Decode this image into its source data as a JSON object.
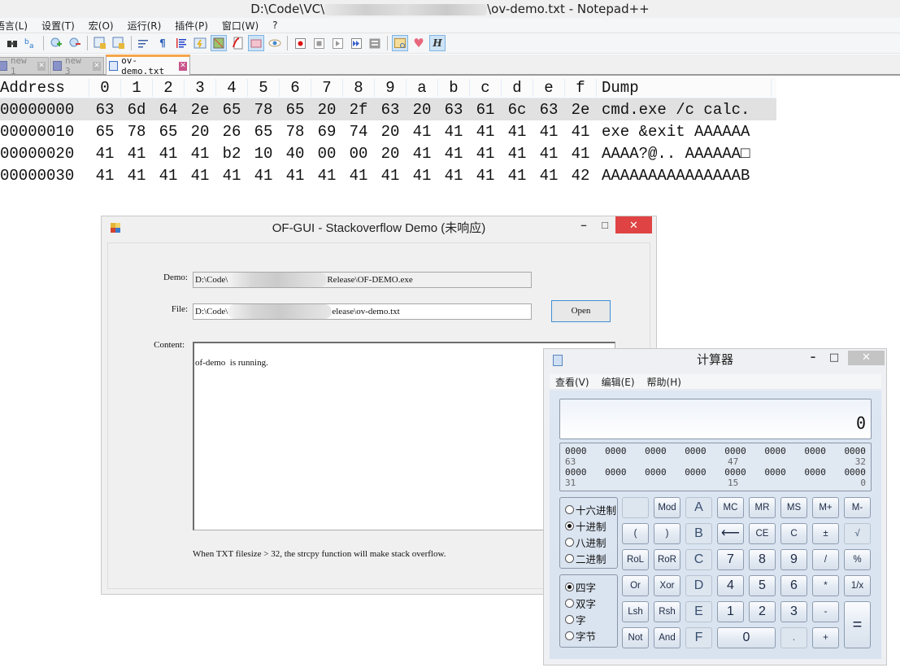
{
  "notepad": {
    "title_prefix": "D:\\Code\\VC\\",
    "title_suffix": "\\ov-demo.txt - Notepad++",
    "menu": [
      "语言(L)",
      "设置(T)",
      "宏(O)",
      "运行(R)",
      "插件(P)",
      "窗口(W)",
      "?"
    ],
    "toolbar_icons": [
      "find-icon",
      "replace-icon",
      "zoom-in-icon",
      "zoom-out-icon",
      "sync-vertical-icon",
      "sync-horizontal-icon",
      "word-wrap-icon",
      "show-all-chars-icon",
      "indent-guide-icon",
      "user-lang-icon",
      "doc-map-icon",
      "function-list-icon",
      "folder-workspace-icon",
      "monitoring-icon",
      "record-macro-icon",
      "stop-macro-icon",
      "play-macro-icon",
      "run-macro-multiple-icon",
      "save-macro-icon",
      "view-hex-icon",
      "heart-icon",
      "hex-editor-icon"
    ],
    "tabs": [
      {
        "label": "new 1",
        "active": false
      },
      {
        "label": "new 3",
        "active": false
      },
      {
        "label": "ov-demo.txt",
        "active": true
      }
    ],
    "hex": {
      "header": {
        "address": "Address",
        "columns": [
          "0",
          "1",
          "2",
          "3",
          "4",
          "5",
          "6",
          "7",
          "8",
          "9",
          "a",
          "b",
          "c",
          "d",
          "e",
          "f"
        ],
        "dump": "Dump"
      },
      "rows": [
        {
          "address": "00000000",
          "bytes": [
            "63",
            "6d",
            "64",
            "2e",
            "65",
            "78",
            "65",
            "20",
            "2f",
            "63",
            "20",
            "63",
            "61",
            "6c",
            "63",
            "2e"
          ],
          "dump": "cmd.exe /c calc.",
          "selected": true
        },
        {
          "address": "00000010",
          "bytes": [
            "65",
            "78",
            "65",
            "20",
            "26",
            "65",
            "78",
            "69",
            "74",
            "20",
            "41",
            "41",
            "41",
            "41",
            "41",
            "41"
          ],
          "dump": "exe &exit AAAAAA",
          "selected": false
        },
        {
          "address": "00000020",
          "bytes": [
            "41",
            "41",
            "41",
            "41",
            "b2",
            "10",
            "40",
            "00",
            "00",
            "20",
            "41",
            "41",
            "41",
            "41",
            "41",
            "41"
          ],
          "dump": "AAAA?@.. AAAAAA□",
          "selected": false
        },
        {
          "address": "00000030",
          "bytes": [
            "41",
            "41",
            "41",
            "41",
            "41",
            "41",
            "41",
            "41",
            "41",
            "41",
            "41",
            "41",
            "41",
            "41",
            "41",
            "42"
          ],
          "dump": "AAAAAAAAAAAAAAAB",
          "selected": false
        }
      ]
    }
  },
  "ofgui": {
    "title": "OF-GUI - Stackoverflow Demo (未响应)",
    "demo_label": "Demo:",
    "demo_value_prefix": "D:\\Code\\",
    "demo_value_suffix": "Release\\OF-DEMO.exe",
    "file_label": "File:",
    "file_value_prefix": "D:\\Code\\",
    "file_value_suffix": "elease\\ov-demo.txt",
    "open_button": "Open",
    "content_label": "Content:",
    "content_text": "of-demo  is running.",
    "hint": "When TXT filesize > 32, the strcpy function will make stack overflow.",
    "minimize": "–",
    "maximize": "□",
    "close": "✕",
    "close_color": "#e04343"
  },
  "calculator": {
    "title": "计算器",
    "menu": [
      "查看(V)",
      "编辑(E)",
      "帮助(H)"
    ],
    "display": "0",
    "bits_rows": [
      {
        "groups": [
          "0000",
          "0000",
          "0000",
          "0000",
          "0000",
          "0000",
          "0000",
          "0000"
        ],
        "indices": [
          "63",
          "47",
          "32"
        ]
      },
      {
        "groups": [
          "0000",
          "0000",
          "0000",
          "0000",
          "0000",
          "0000",
          "0000",
          "0000"
        ],
        "indices": [
          "31",
          "15",
          "0"
        ]
      }
    ],
    "base_radios": [
      {
        "label": "十六进制",
        "checked": false
      },
      {
        "label": "十进制",
        "checked": true
      },
      {
        "label": "八进制",
        "checked": false
      },
      {
        "label": "二进制",
        "checked": false
      }
    ],
    "word_radios": [
      {
        "label": "四字",
        "checked": true
      },
      {
        "label": "双字",
        "checked": false
      },
      {
        "label": "字",
        "checked": false
      },
      {
        "label": "字节",
        "checked": false
      }
    ],
    "keys": {
      "blank": "",
      "mod": "Mod",
      "a": "A",
      "mc": "MC",
      "mr": "MR",
      "ms": "MS",
      "mplus": "M+",
      "mminus": "M-",
      "lparen": "(",
      "rparen": ")",
      "b": "B",
      "back": "⟵",
      "ce": "CE",
      "c": "C",
      "neg": "±",
      "sqrt": "√",
      "rol": "RoL",
      "ror": "RoR",
      "c_hex": "C",
      "seven": "7",
      "eight": "8",
      "nine": "9",
      "div": "/",
      "pct": "%",
      "or": "Or",
      "xor": "Xor",
      "d": "D",
      "four": "4",
      "five": "5",
      "six": "6",
      "mul": "*",
      "inv": "1/x",
      "lsh": "Lsh",
      "rsh": "Rsh",
      "e": "E",
      "one": "1",
      "two": "2",
      "three": "3",
      "sub": "-",
      "eq": "=",
      "not": "Not",
      "and": "And",
      "f": "F",
      "zero": "0",
      "dot": ".",
      "add": "+"
    }
  }
}
